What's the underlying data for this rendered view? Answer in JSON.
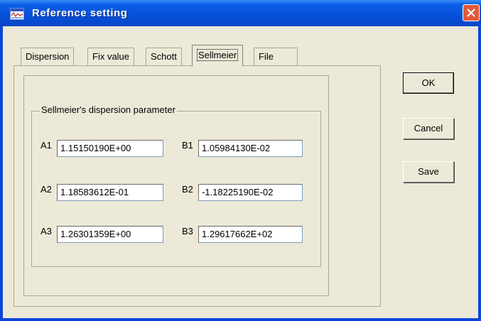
{
  "window": {
    "title": "Reference setting",
    "titlebar_color": "#0a5fe8",
    "close_color": "#e2593a"
  },
  "tabs": [
    {
      "label": "Dispersion"
    },
    {
      "label": "Fix value"
    },
    {
      "label": "Schott"
    },
    {
      "label": "Sellmeier"
    },
    {
      "label": "File"
    }
  ],
  "active_tab": "Sellmeier",
  "group": {
    "label": "Sellmeier's dispersion parameter"
  },
  "params": {
    "A1": {
      "label": "A1",
      "value": "1.15150190E+00"
    },
    "B1": {
      "label": "B1",
      "value": "1.05984130E-02"
    },
    "A2": {
      "label": "A2",
      "value": "1.18583612E-01"
    },
    "B2": {
      "label": "B2",
      "value": "-1.18225190E-02"
    },
    "A3": {
      "label": "A3",
      "value": "1.26301359E+00"
    },
    "B3": {
      "label": "B3",
      "value": "1.29617662E+02"
    }
  },
  "buttons": {
    "ok": "OK",
    "cancel": "Cancel",
    "save": "Save"
  }
}
